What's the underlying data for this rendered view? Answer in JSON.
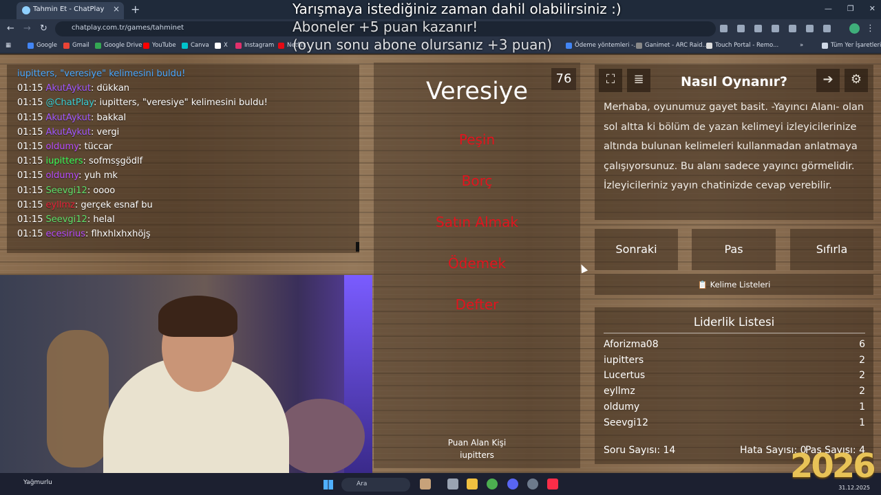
{
  "browser": {
    "tab_title": "Tahmin Et - ChatPlay",
    "url": "chatplay.com.tr/games/tahminet",
    "bookmarks": [
      {
        "label": "Google",
        "color": "#4285f4"
      },
      {
        "label": "Gmail",
        "color": "#ea4335"
      },
      {
        "label": "Google Drive",
        "color": "#34a853"
      },
      {
        "label": "YouTube",
        "color": "#ff0000"
      },
      {
        "label": "Canva",
        "color": "#00c4cc"
      },
      {
        "label": "X",
        "color": "#ffffff"
      },
      {
        "label": "Instagram",
        "color": "#e1306c"
      },
      {
        "label": "Netflix",
        "color": "#e50914"
      },
      {
        "label": "Ödeme yöntemleri -...",
        "color": "#4285f4"
      },
      {
        "label": "Ganimet - ARC Raid...",
        "color": "#888888"
      },
      {
        "label": "Touch Portal - Remo...",
        "color": "#dddddd"
      },
      {
        "label": "Tüm Yer İşaretleri",
        "color": "#cfd8e6"
      }
    ]
  },
  "announcement": {
    "line1": "Yarışmaya istediğiniz zaman dahil olabilirsiniz :)",
    "line2": "Aboneler +5 puan kazanır!",
    "line3": "(oyun sonu abone olursanız +3 puan)"
  },
  "chat": {
    "messages": [
      {
        "time": "",
        "user": "iupitters, \"veresiye\" kelimesini buldu!",
        "user_color": "#4aa8ff",
        "text": ""
      },
      {
        "time": "01:15",
        "user": "AkutAykut",
        "user_color": "#a259ff",
        "text": ": dükkan"
      },
      {
        "time": "01:15",
        "user": "@ChatPlay",
        "user_color": "#39d0d6",
        "text": ": iupitters, \"veresiye\" kelimesini buldu!"
      },
      {
        "time": "01:15",
        "user": "AkutAykut",
        "user_color": "#a259ff",
        "text": ": bakkal"
      },
      {
        "time": "01:15",
        "user": "AkutAykut",
        "user_color": "#a259ff",
        "text": ": vergi"
      },
      {
        "time": "01:15",
        "user": "oldumy",
        "user_color": "#b84cff",
        "text": ": tüccar"
      },
      {
        "time": "01:15",
        "user": "iupitters",
        "user_color": "#3dff5a",
        "text": ": sofmsşgödlf"
      },
      {
        "time": "01:15",
        "user": "oldumy",
        "user_color": "#b84cff",
        "text": ": yuh mk"
      },
      {
        "time": "01:15",
        "user": "Seevgi12",
        "user_color": "#5ee06a",
        "text": ": oooo"
      },
      {
        "time": "01:15",
        "user": "eyllmz",
        "user_color": "#e8223a",
        "text": ": gerçek esnaf bu"
      },
      {
        "time": "01:15",
        "user": "Seevgi12",
        "user_color": "#5ee06a",
        "text": ": helal"
      },
      {
        "time": "01:15",
        "user": "ecesirius",
        "user_color": "#b84cff",
        "text": ": flhxhlxhxhöjş"
      }
    ]
  },
  "game": {
    "timer": "76",
    "word": "Veresiye",
    "forbidden": [
      "Peşin",
      "Borç",
      "Satın Almak",
      "Ödemek",
      "Defter"
    ],
    "scorer_label": "Puan Alan Kişi",
    "scorer_name": "iupitters"
  },
  "how_to": {
    "title": "Nasıl Oynanır?",
    "text": "Merhaba, oyunumuz gayet basit. -Yayıncı Alanı- olan sol altta ki bölüm de yazan kelimeyi izleyicilerinize altında bulunan kelimeleri kullanmadan anlatmaya çalışıyorsunuz. Bu alanı sadece yayıncı görmelidir. İzleyicileriniz yayın chatinizde cevap verebilir."
  },
  "buttons": {
    "next": "Sonraki",
    "pass": "Pas",
    "reset": "Sıfırla",
    "word_lists": "Kelime Listeleri"
  },
  "leaderboard": {
    "title": "Liderlik Listesi",
    "rows": [
      {
        "name": "Aforizma08",
        "score": "6"
      },
      {
        "name": "iupitters",
        "score": "2"
      },
      {
        "name": "Lucertus",
        "score": "2"
      },
      {
        "name": "eyllmz",
        "score": "2"
      },
      {
        "name": "oldumy",
        "score": "1"
      },
      {
        "name": "Seevgi12",
        "score": "1"
      }
    ],
    "question_count": "Soru Sayısı: 14",
    "error_count": "Hata Sayısı: 0",
    "pass_count": "Pas Sayısı: 4"
  },
  "taskbar": {
    "weather": "Yağmurlu",
    "search": "Ara",
    "date": "31.12.2025",
    "year_overlay": "2026"
  }
}
